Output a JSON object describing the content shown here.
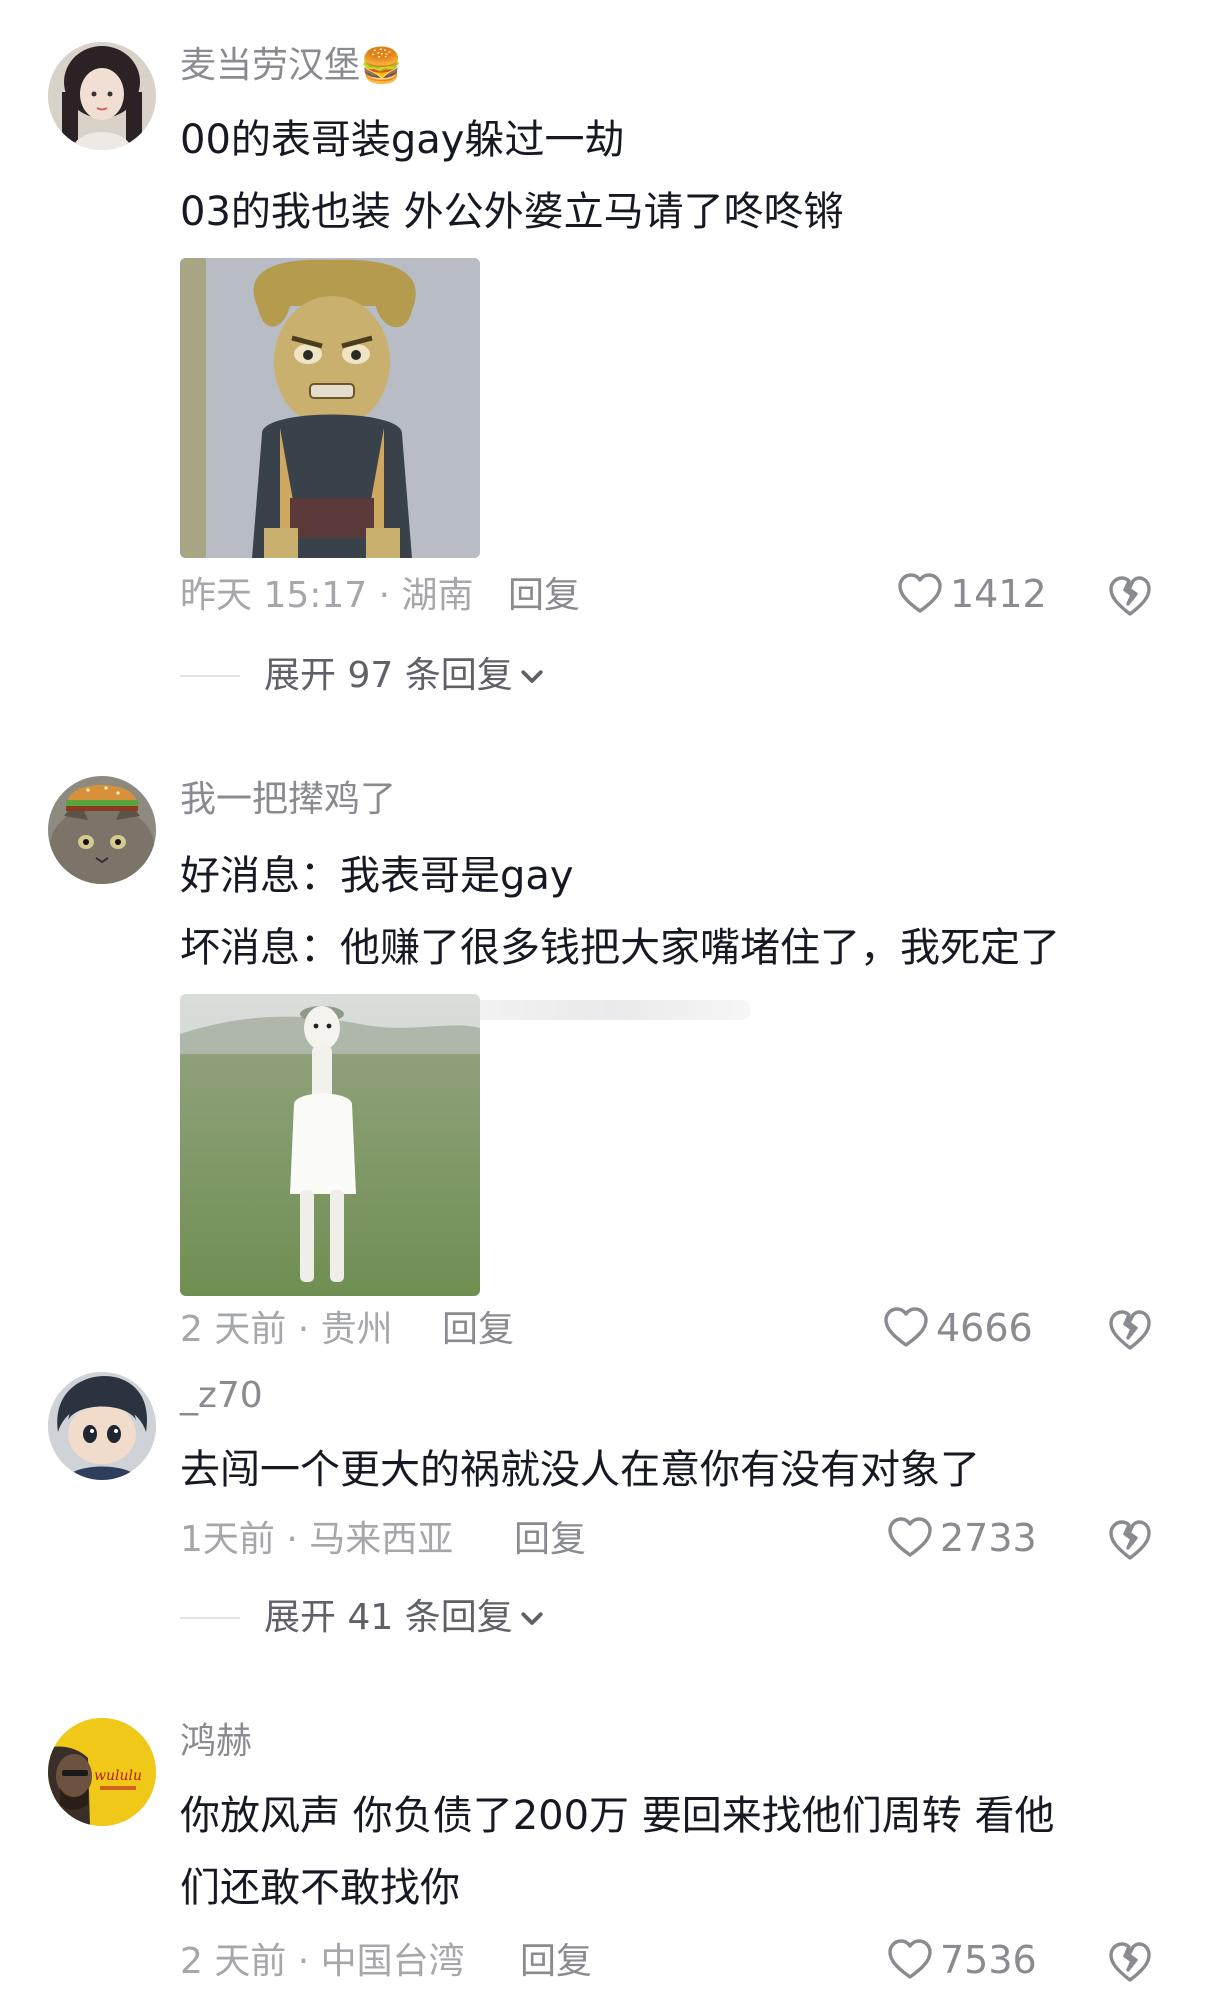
{
  "comments": [
    {
      "username": "麦当劳汉堡",
      "username_emoji": "🍔",
      "lines": [
        "00的表哥装gay躲过一劫",
        "03的我也装 外公外婆立马请了咚咚锵"
      ],
      "meta": "昨天 15:17 · 湖南",
      "reply": "回复",
      "likes": "1412",
      "expand": "展开 97 条回复"
    },
    {
      "username": "我一把撵鸡了",
      "lines": [
        "好消息：我表哥是gay",
        "坏消息：他赚了很多钱把大家嘴堵住了，我死定了"
      ],
      "meta": "2 天前 · 贵州",
      "reply": "回复",
      "likes": "4666"
    },
    {
      "username": "_z70",
      "lines": [
        "去闯一个更大的祸就没人在意你有没有对象了"
      ],
      "meta": "1天前 · 马来西亚",
      "reply": "回复",
      "likes": "2733",
      "expand": "展开 41 条回复"
    },
    {
      "username": "鸿赫",
      "lines": [
        "你放风声 你负债了200万  要回来找他们周转 看他",
        "们还敢不敢找你"
      ],
      "meta": "2 天前 · 中国台湾",
      "reply": "回复",
      "likes": "7536"
    }
  ],
  "avatar_4_text": "wululu"
}
